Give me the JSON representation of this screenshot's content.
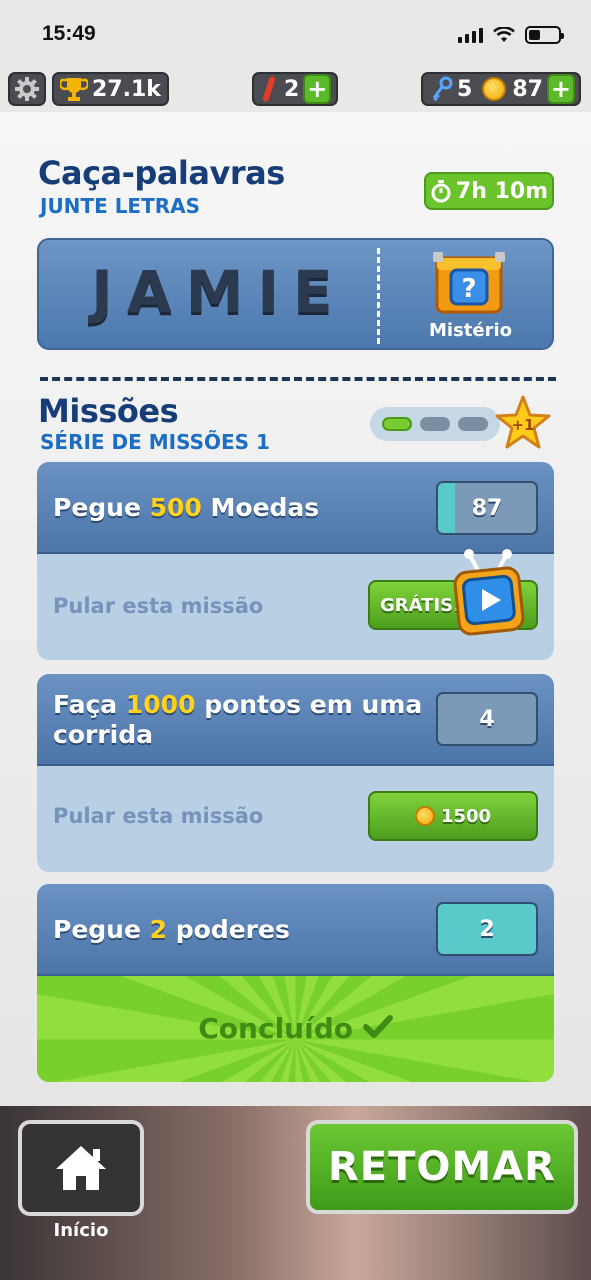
{
  "status": {
    "time": "15:49"
  },
  "top": {
    "trophies": "27.1k",
    "boards": "2",
    "keys": "5",
    "coins": "87",
    "plus": "+"
  },
  "word_hunt": {
    "title": "Caça-palavras",
    "subtitle": "JUNTE LETRAS",
    "timer": "7h 10m",
    "letters": "JAMIE",
    "mystery_label": "Mistério"
  },
  "missions": {
    "title": "Missões",
    "subtitle": "SÉRIE DE MISSÕES 1",
    "reward_badge": "+1",
    "progress_segments_done": 1,
    "progress_segments_total": 3,
    "items": [
      {
        "text_before": "Pegue ",
        "highlight": "500",
        "text_after": " Moedas",
        "count": "87",
        "progress": 0.174,
        "skip_label": "Pular esta missão",
        "button_label": "GRÁTIS!"
      },
      {
        "text_before": "Faça ",
        "highlight": "1000",
        "text_after": " pontos em uma corrida",
        "count": "4",
        "progress": 0.004,
        "skip_label": "Pular esta missão",
        "button_label": "1500"
      },
      {
        "text_before": "Pegue ",
        "highlight": "2",
        "text_after": " poderes",
        "count": "2",
        "progress": 1,
        "done_label": "Concluído"
      }
    ]
  },
  "bottom": {
    "home_label": "Início",
    "resume_label": "RETOMAR"
  },
  "colors": {
    "title_blue": "#163d78",
    "accent_green": "#6cc42d",
    "highlight_yellow": "#ffd21e"
  }
}
